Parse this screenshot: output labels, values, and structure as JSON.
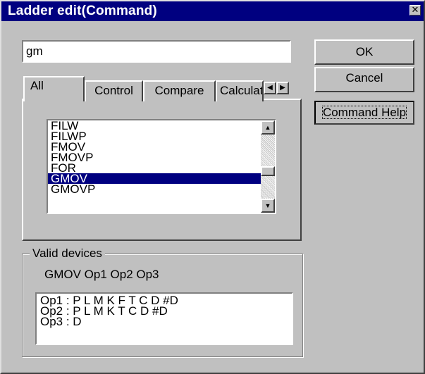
{
  "window": {
    "title": "Ladder edit(Command)",
    "close_glyph": "✕"
  },
  "command_input": {
    "value": "gm"
  },
  "buttons": {
    "ok": "OK",
    "cancel": "Cancel",
    "help": "Command Help"
  },
  "tabs": [
    {
      "label": "All",
      "active": true
    },
    {
      "label": "Control",
      "active": false
    },
    {
      "label": "Compare",
      "active": false
    },
    {
      "label": "Calculati",
      "active": false
    }
  ],
  "tab_scroll": {
    "left": "◀",
    "right": "▶"
  },
  "command_list": {
    "items": [
      "FILW",
      "FILWP",
      "FMOV",
      "FMOVP",
      "FOR",
      "GMOV",
      "GMOVP"
    ],
    "selected": "GMOV",
    "scroll_up": "▲",
    "scroll_down": "▼"
  },
  "valid_devices": {
    "label": "Valid devices",
    "summary": "GMOV Op1 Op2 Op3",
    "operands": [
      "Op1 : P L M K F T C D #D",
      "Op2 : P L M K T C D #D",
      "Op3 : D"
    ]
  },
  "colors": {
    "titlebar": "#000080",
    "face": "#c0c0c0",
    "selection": "#000080"
  },
  "icons": {
    "close": "close-icon",
    "tab_left": "arrow-left-icon",
    "tab_right": "arrow-right-icon",
    "scroll_up": "arrow-up-icon",
    "scroll_down": "arrow-down-icon"
  }
}
